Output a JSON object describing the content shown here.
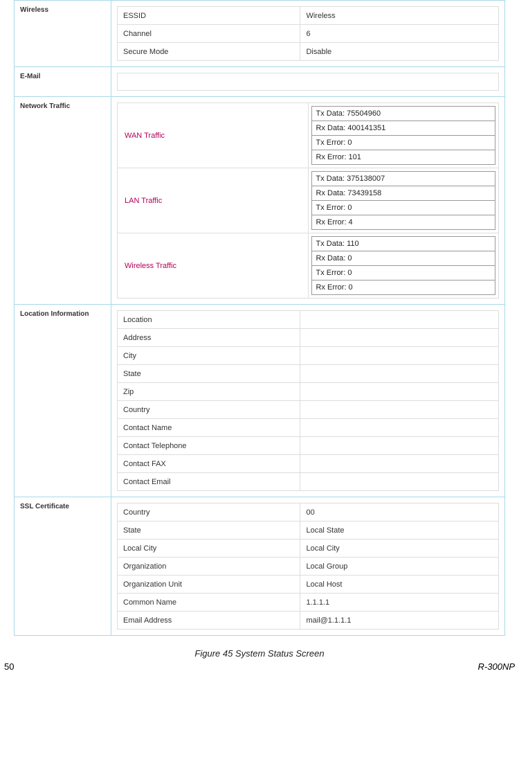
{
  "sections": {
    "wireless": {
      "title": "Wireless",
      "rows": [
        {
          "key": "ESSID",
          "val": "Wireless"
        },
        {
          "key": "Channel",
          "val": "6"
        },
        {
          "key": "Secure Mode",
          "val": "Disable"
        }
      ]
    },
    "email": {
      "title": "E-Mail"
    },
    "network_traffic": {
      "title": "Network Traffic",
      "groups": [
        {
          "label": "WAN Traffic",
          "stats": [
            "Tx Data: 75504960",
            "Rx Data: 400141351",
            "Tx Error: 0",
            "Rx Error: 101"
          ]
        },
        {
          "label": "LAN Traffic",
          "stats": [
            "Tx Data: 375138007",
            "Rx Data: 73439158",
            "Tx Error: 0",
            "Rx Error: 4"
          ]
        },
        {
          "label": "Wireless Traffic",
          "stats": [
            "Tx Data: 110",
            "Rx Data: 0",
            "Tx Error: 0",
            "Rx Error: 0"
          ]
        }
      ]
    },
    "location_information": {
      "title": "Location Information",
      "rows": [
        {
          "key": "Location",
          "val": ""
        },
        {
          "key": "Address",
          "val": ""
        },
        {
          "key": "City",
          "val": ""
        },
        {
          "key": "State",
          "val": ""
        },
        {
          "key": "Zip",
          "val": ""
        },
        {
          "key": "Country",
          "val": ""
        },
        {
          "key": "Contact Name",
          "val": ""
        },
        {
          "key": "Contact Telephone",
          "val": ""
        },
        {
          "key": "Contact FAX",
          "val": ""
        },
        {
          "key": "Contact Email",
          "val": ""
        }
      ]
    },
    "ssl_certificate": {
      "title": "SSL Certificate",
      "rows": [
        {
          "key": "Country",
          "val": "00"
        },
        {
          "key": "State",
          "val": "Local State"
        },
        {
          "key": "Local City",
          "val": "Local City"
        },
        {
          "key": "Organization",
          "val": "Local Group"
        },
        {
          "key": "Organization Unit",
          "val": "Local Host"
        },
        {
          "key": "Common Name",
          "val": "1.1.1.1"
        },
        {
          "key": "Email Address",
          "val": "mail@1.1.1.1"
        }
      ]
    }
  },
  "caption": "Figure 45 System Status Screen",
  "page_number": "50",
  "model": "R-300NP"
}
